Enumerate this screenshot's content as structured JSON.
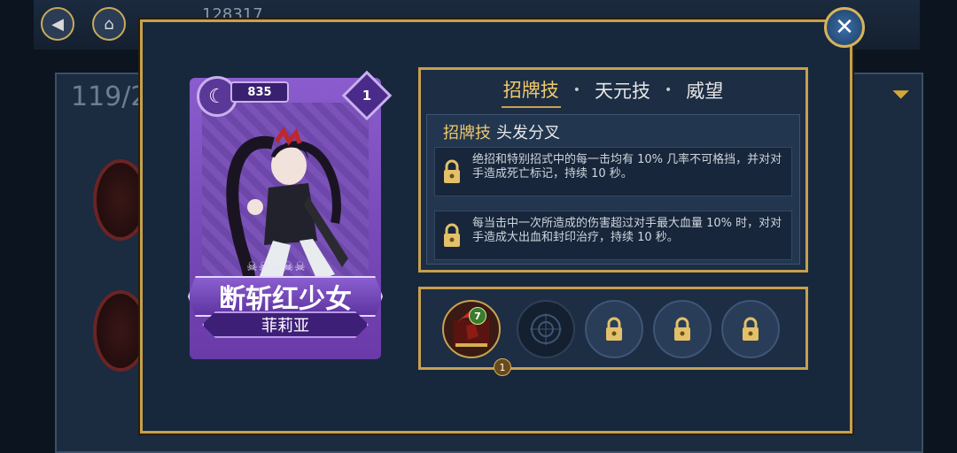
{
  "background": {
    "currency_count": "128317",
    "collection_count": "119/2"
  },
  "character": {
    "power": "835",
    "level": "1",
    "title": "断斩红少女",
    "name": "菲莉亚",
    "card_color": "#7a4cc0"
  },
  "skills_panel": {
    "tabs": [
      {
        "label": "招牌技",
        "active": true
      },
      {
        "label": "天元技",
        "active": false
      },
      {
        "label": "威望",
        "active": false
      }
    ],
    "skill_type": "招牌技",
    "skill_name": "头发分叉",
    "effects": [
      {
        "text": "绝招和特别招式中的每一击均有 10% 几率不可格挡，并对对手造成死亡标记，持续 10 秒。",
        "locked": true
      },
      {
        "text": "每当击中一次所造成的伤害超过对手最大血量 10% 时，对对手造成大出血和封印治疗，持续 10 秒。",
        "locked": true
      }
    ]
  },
  "equipment": {
    "item_level": "7",
    "item_count": "1",
    "slots": [
      "equipped",
      "empty",
      "locked",
      "locked",
      "locked"
    ]
  },
  "colors": {
    "gold": "#c7a04e",
    "tab_active": "#f0c96a",
    "panel_bg": "#18283c"
  }
}
